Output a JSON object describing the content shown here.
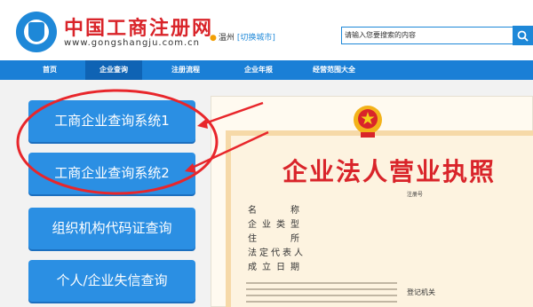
{
  "header": {
    "logo_title": "中国工商注册网",
    "logo_url": "www.gongshangju.com.cn",
    "location": {
      "city": "温州",
      "switch_label": "[切换城市]"
    },
    "search": {
      "placeholder": "请输入您要搜索的内容"
    }
  },
  "nav": {
    "items": [
      {
        "label": "首页"
      },
      {
        "label": "企业查询"
      },
      {
        "label": "注册流程"
      },
      {
        "label": "企业年报"
      },
      {
        "label": "经营范围大全"
      }
    ],
    "active_index": 1
  },
  "side_buttons": [
    {
      "label": "工商企业查询系统1"
    },
    {
      "label": "工商企业查询系统2"
    },
    {
      "label": "组织机构代码证查询"
    },
    {
      "label": "个人/企业失信查询"
    }
  ],
  "license": {
    "title": "企业法人营业执照",
    "reg_no_label": "注册号",
    "fields": [
      {
        "label": "名　　称"
      },
      {
        "label": "企业类型"
      },
      {
        "label": "住　　所"
      },
      {
        "label": "法定代表人"
      },
      {
        "label": "成立日期"
      }
    ],
    "reg_org_label": "登记机关"
  },
  "colors": {
    "brand_blue": "#1a7fd6",
    "button_blue": "#2b8fe3",
    "annotation_red": "#e8262b",
    "title_red": "#d9242a"
  }
}
